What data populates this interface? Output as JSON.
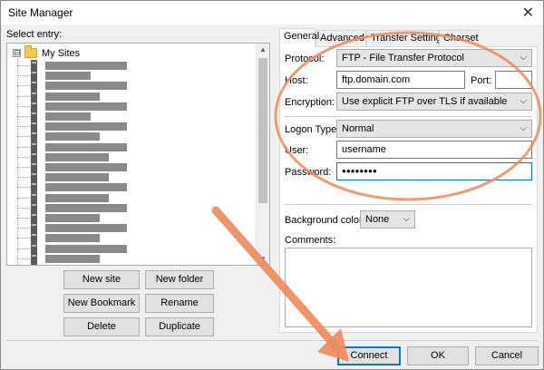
{
  "window": {
    "title": "Site Manager",
    "close_glyph": "✕"
  },
  "left": {
    "select_label": "Select entry:",
    "root_label": "My Sites",
    "expander_glyph": "⊟",
    "buttons": {
      "new_site": "New site",
      "new_folder": "New folder",
      "new_bookmark": "New Bookmark",
      "rename": "Rename",
      "delete": "Delete",
      "duplicate": "Duplicate"
    }
  },
  "tabs": [
    "General",
    "Advanced",
    "Transfer Settings",
    "Charset"
  ],
  "general": {
    "protocol_label": "Protocol:",
    "protocol_value": "FTP - File Transfer Protocol",
    "host_label": "Host:",
    "host_value": "ftp.domain.com",
    "port_label": "Port:",
    "port_value": "",
    "encryption_label": "Encryption:",
    "encryption_value": "Use explicit FTP over TLS if available",
    "logon_type_label": "Logon Type:",
    "logon_type_value": "Normal",
    "user_label": "User:",
    "user_value": "username",
    "password_label": "Password:",
    "password_value": "●●●●●●●●",
    "background_color_label": "Background color:",
    "background_color_value": "None",
    "comments_label": "Comments:",
    "comments_value": ""
  },
  "footer": {
    "connect": "Connect",
    "ok": "OK",
    "cancel": "Cancel"
  },
  "annotation": {
    "color": "#ef8a5a"
  },
  "icons": {
    "chevron": "⌵"
  }
}
